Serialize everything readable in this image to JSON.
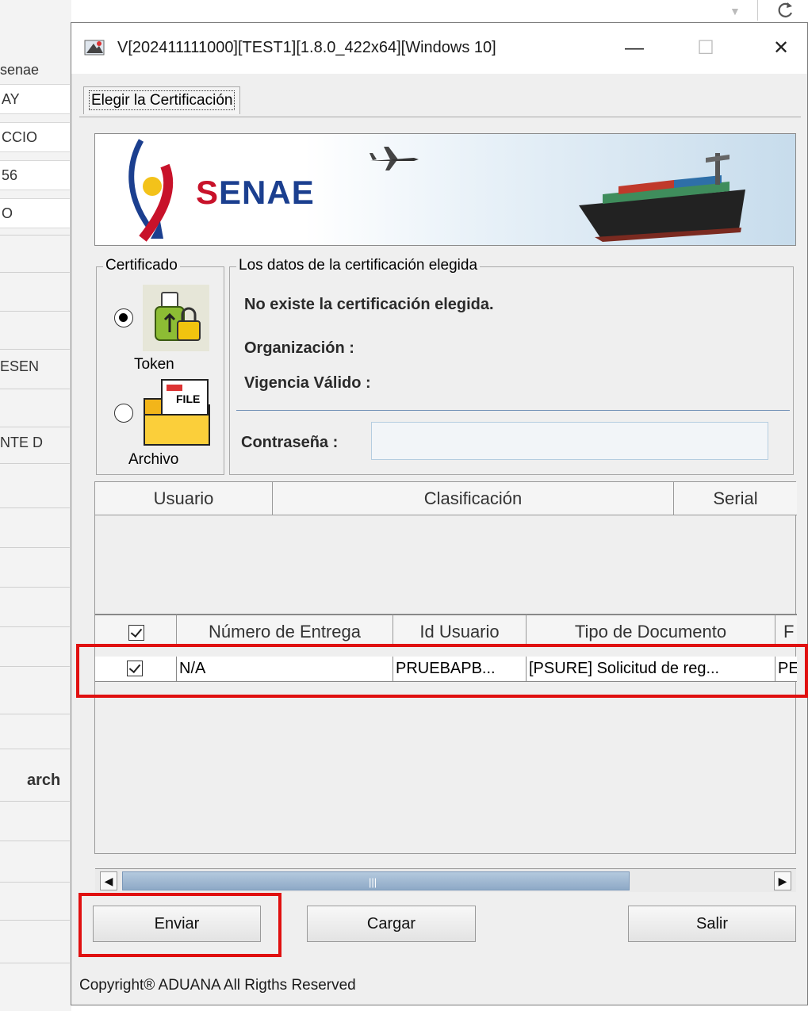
{
  "background_app": {
    "rows": [
      "senae",
      "AY",
      "CCIO",
      "56",
      "O",
      "ESEN",
      "NTE D",
      "arch"
    ],
    "toolbar": {
      "dropdown_arrow": "▼",
      "refresh_icon": "refresh-icon"
    }
  },
  "window": {
    "title": "V[202411111000][TEST1][1.8.0_422x64][Windows 10]",
    "controls": {
      "minimize": "—",
      "maximize": "☐",
      "close": "✕"
    }
  },
  "tab": {
    "label": "Elegir la Certificación"
  },
  "banner": {
    "brand_part1": "S",
    "brand_part2": "ENAE"
  },
  "certificado": {
    "legend": "Certificado",
    "options": [
      {
        "label": "Token",
        "selected": true,
        "icon": "usb-token-icon"
      },
      {
        "label": "Archivo",
        "selected": false,
        "icon": "file-folder-icon",
        "icon_text": "FILE"
      }
    ]
  },
  "datos": {
    "legend": "Los datos de la certificación elegida",
    "status": "No existe la certificación elegida.",
    "organizacion_label": "Organización :",
    "vigencia_label": "Vigencia Válido :",
    "password_label": "Contraseña :",
    "password_value": ""
  },
  "user_table": {
    "columns": [
      "Usuario",
      "Clasificación",
      "Serial"
    ],
    "rows": []
  },
  "docs_table": {
    "columns": [
      "Número de Entrega",
      "Id Usuario",
      "Tipo de Documento",
      "F"
    ],
    "header_checked": true,
    "rows": [
      {
        "checked": true,
        "numero": "N/A",
        "id_usuario": "PRUEBAPB...",
        "tipo": "[PSURE] Solicitud de reg...",
        "extra": "PE"
      }
    ]
  },
  "scrollbar": {
    "left_arrow": "◀",
    "right_arrow": "▶",
    "grip": "|||"
  },
  "buttons": {
    "enviar": "Enviar",
    "cargar": "Cargar",
    "salir": "Salir"
  },
  "footer": {
    "copyright": "Copyright® ADUANA All Rigths Reserved"
  },
  "colors": {
    "accent_red": "#e01010",
    "brand_blue": "#1b3f8f",
    "brand_red": "#c8122a"
  }
}
